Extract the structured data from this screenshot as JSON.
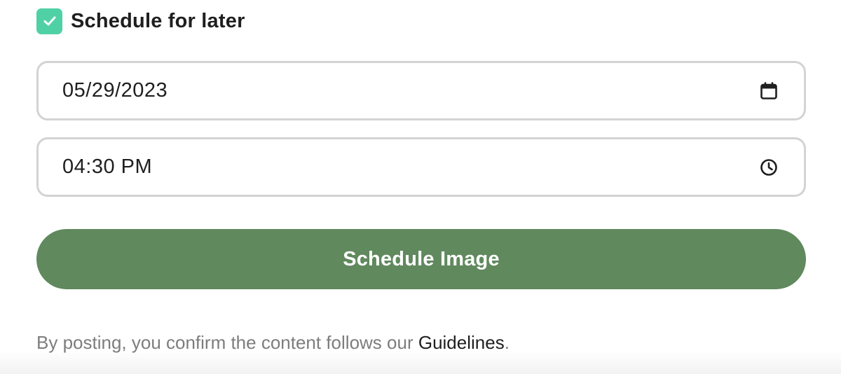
{
  "schedule": {
    "checkbox_checked": true,
    "checkbox_color": "#4fd1a5",
    "label": "Schedule for later"
  },
  "date_field": {
    "value": "05/29/2023",
    "icon": "calendar-icon"
  },
  "time_field": {
    "value": "04:30 PM",
    "icon": "clock-icon"
  },
  "submit": {
    "label": "Schedule Image",
    "color": "#60895e"
  },
  "disclaimer": {
    "prefix": "By posting, you confirm the content follows our ",
    "link": "Guidelines",
    "suffix": "."
  }
}
